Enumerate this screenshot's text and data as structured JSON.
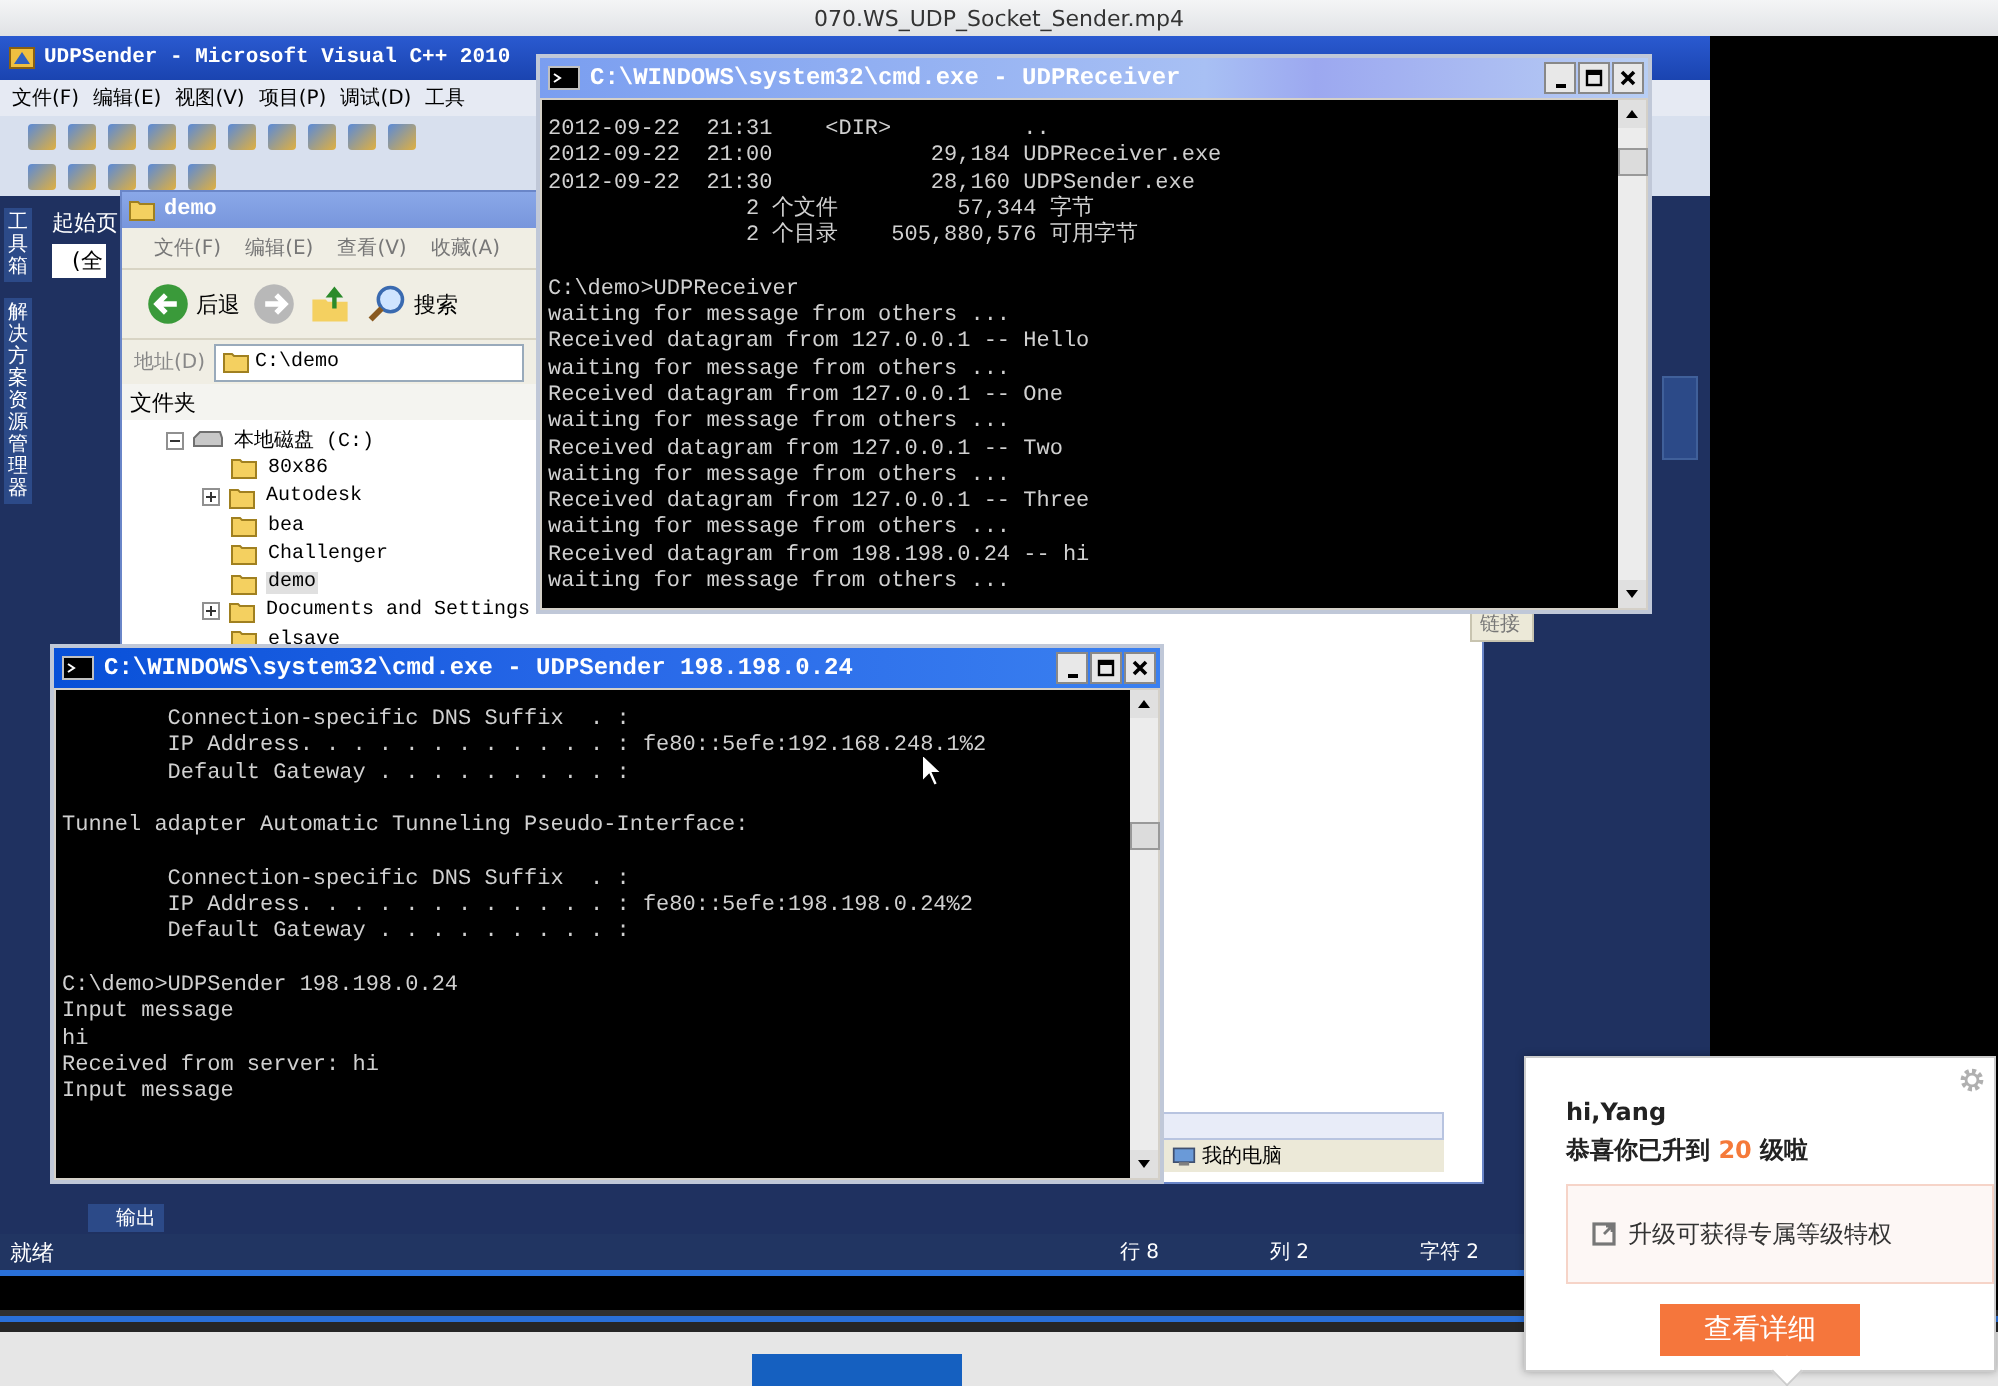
{
  "player": {
    "title": "070.WS_UDP_Socket_Sender.mp4"
  },
  "ide": {
    "title": "UDPSender - Microsoft Visual C++ 2010",
    "menu": [
      "文件(F)",
      "编辑(E)",
      "视图(V)",
      "项目(P)",
      "调试(D)",
      "工具"
    ],
    "side_tabs": [
      "工具箱",
      "解决方案资源管理器"
    ],
    "start_tab": "起始页",
    "scope_field": "(全",
    "output_tab": "输出",
    "status": [
      "就绪",
      "行 8",
      "列 2",
      "字符 2"
    ]
  },
  "explorer": {
    "title": "demo",
    "menu": [
      "文件(F)",
      "编辑(E)",
      "查看(V)",
      "收藏(A)"
    ],
    "back": "后退",
    "search": "搜索",
    "address_label": "地址(D)",
    "address": "C:\\demo",
    "folders_label": "文件夹",
    "drive": "本地磁盘 (C:)",
    "tree": [
      {
        "label": "80x86",
        "expandable": false,
        "selected": false
      },
      {
        "label": "Autodesk",
        "expandable": true,
        "selected": false
      },
      {
        "label": "bea",
        "expandable": false,
        "selected": false
      },
      {
        "label": "Challenger",
        "expandable": false,
        "selected": false
      },
      {
        "label": "demo",
        "expandable": false,
        "selected": true
      },
      {
        "label": "Documents and Settings",
        "expandable": true,
        "selected": false
      },
      {
        "label": "elsave",
        "expandable": false,
        "selected": false
      }
    ],
    "links": "链接",
    "status_location": "我的电脑"
  },
  "consoles": [
    {
      "title": "C:\\WINDOWS\\system32\\cmd.exe - UDPReceiver",
      "active": false,
      "lines": [
        {
          "text": "2012-09-22  21:31    <DIR>          ..",
          "gap_before": false
        },
        {
          "text": "2012-09-22  21:00            29,184 UDPReceiver.exe",
          "gap_before": false
        },
        {
          "text": "2012-09-22  21:30            28,160 UDPSender.exe",
          "gap_before": false
        },
        {
          "text": "               2 个文件         57,344 字节",
          "gap_before": false
        },
        {
          "text": "               2 个目录    505,880,576 可用字节",
          "gap_before": false
        },
        {
          "text": "C:\\demo>UDPReceiver",
          "gap_before": true
        },
        {
          "text": "waiting for message from others ...",
          "gap_before": false
        },
        {
          "text": "Received datagram from 127.0.0.1 -- Hello",
          "gap_before": false
        },
        {
          "text": "waiting for message from others ...",
          "gap_before": false
        },
        {
          "text": "Received datagram from 127.0.0.1 -- One",
          "gap_before": false
        },
        {
          "text": "waiting for message from others ...",
          "gap_before": false
        },
        {
          "text": "Received datagram from 127.0.0.1 -- Two",
          "gap_before": false
        },
        {
          "text": "waiting for message from others ...",
          "gap_before": false
        },
        {
          "text": "Received datagram from 127.0.0.1 -- Three",
          "gap_before": false
        },
        {
          "text": "waiting for message from others ...",
          "gap_before": false
        },
        {
          "text": "Received datagram from 198.198.0.24 -- hi",
          "gap_before": false
        },
        {
          "text": "waiting for message from others ...",
          "gap_before": false
        }
      ]
    },
    {
      "title": "C:\\WINDOWS\\system32\\cmd.exe - UDPSender 198.198.0.24",
      "active": true,
      "lines": [
        {
          "text": "        Connection-specific DNS Suffix  . :",
          "gap_before": false
        },
        {
          "text": "        IP Address. . . . . . . . . . . . : fe80::5efe:192.168.248.1%2",
          "gap_before": false
        },
        {
          "text": "        Default Gateway . . . . . . . . . :",
          "gap_before": false
        },
        {
          "text": "Tunnel adapter Automatic Tunneling Pseudo-Interface:",
          "gap_before": true
        },
        {
          "text": "        Connection-specific DNS Suffix  . :",
          "gap_before": true
        },
        {
          "text": "        IP Address. . . . . . . . . . . . : fe80::5efe:198.198.0.24%2",
          "gap_before": false
        },
        {
          "text": "        Default Gateway . . . . . . . . . :",
          "gap_before": false
        },
        {
          "text": "C:\\demo>UDPSender 198.198.0.24",
          "gap_before": true
        },
        {
          "text": "Input message",
          "gap_before": false
        },
        {
          "text": "hi",
          "gap_before": false
        },
        {
          "text": "Received from server: hi",
          "gap_before": false
        },
        {
          "text": "Input message",
          "gap_before": false
        }
      ]
    }
  ],
  "popup": {
    "greeting": "hi,Yang",
    "message": "恭喜你已升到 **20** 级啦",
    "perk": "升级可获得专属等级特权",
    "button": "查看详细"
  }
}
